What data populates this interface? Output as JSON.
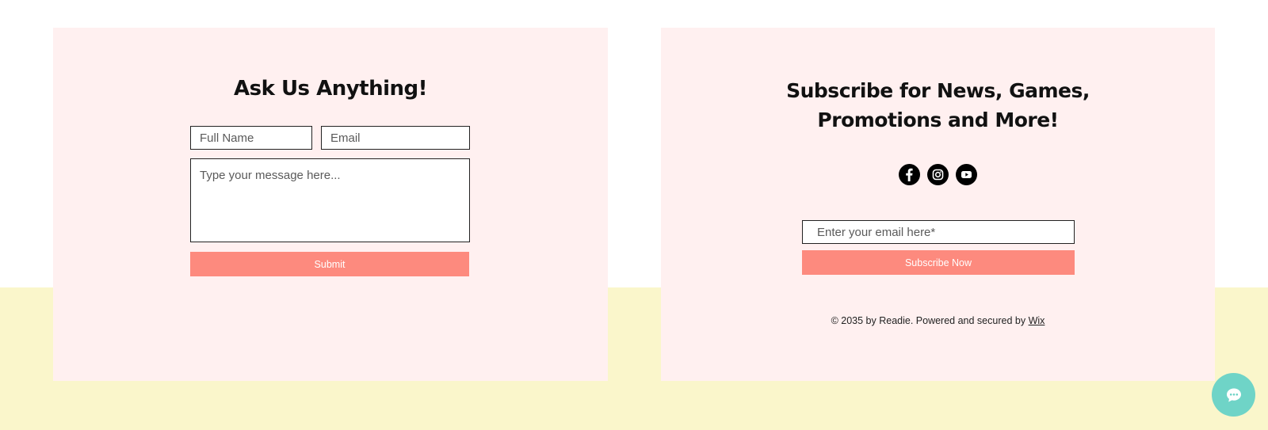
{
  "contact": {
    "heading": "Ask Us Anything!",
    "name_placeholder": "Full Name",
    "email_placeholder": "Email",
    "message_placeholder": "Type your message here...",
    "submit_label": "Submit"
  },
  "subscribe": {
    "heading_line1": "Subscribe for News, Games,",
    "heading_line2": "Promotions and More!",
    "social_icons": [
      "facebook-icon",
      "instagram-icon",
      "youtube-icon"
    ],
    "email_placeholder": "Enter your email here*",
    "button_label": "Subscribe Now"
  },
  "footer": {
    "text": "© 2035 by Readie. Powered and secured by",
    "link_label": "Wix"
  },
  "chat": {
    "icon": "chat-icon"
  },
  "colors": {
    "panel_bg": "#fff0f0",
    "band_bg": "#faf6cb",
    "button_bg": "#fd8a7e",
    "chat_bg": "#6fd4c7"
  }
}
